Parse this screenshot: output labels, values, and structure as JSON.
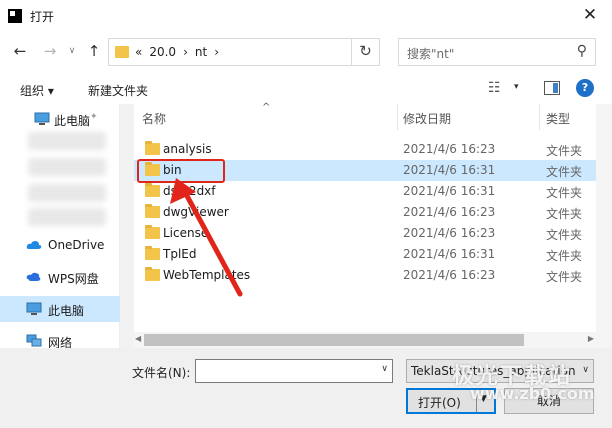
{
  "window": {
    "title": "打开",
    "close_glyph": "✕"
  },
  "nav": {
    "back": "←",
    "forward": "→",
    "down": "∨",
    "up": "↑",
    "breadcrumb": [
      "«",
      "20.0",
      "›",
      "nt",
      "›"
    ],
    "refresh": "↻",
    "addr_drop": "∨",
    "search_placeholder": "搜索\"nt\"",
    "search_icon": "⚲"
  },
  "toolbar": {
    "organize": "组织 ▾",
    "new_folder": "新建文件夹",
    "view_icon": "☷",
    "view_arrow": "▾",
    "help": "?"
  },
  "sidebar": {
    "items": [
      {
        "label": "此电脑",
        "icon": "computer-icon"
      },
      {
        "label": "OneDrive",
        "icon": "cloud-icon"
      },
      {
        "label": "WPS网盘",
        "icon": "wps-icon"
      },
      {
        "label": "此电脑",
        "icon": "computer-icon"
      },
      {
        "label": "网络",
        "icon": "network-icon"
      }
    ],
    "pin": "📌"
  },
  "columns": {
    "name": "名称",
    "date": "修改日期",
    "type": "类型",
    "sort_arrow": "^"
  },
  "files": [
    {
      "name": "analysis",
      "date": "2021/4/6 16:23",
      "type": "文件夹"
    },
    {
      "name": "bin",
      "date": "2021/4/6 16:31",
      "type": "文件夹"
    },
    {
      "name": "dsta2dxf",
      "date": "2021/4/6 16:31",
      "type": "文件夹"
    },
    {
      "name": "dwgViewer",
      "date": "2021/4/6 16:23",
      "type": "文件夹"
    },
    {
      "name": "License",
      "date": "2021/4/6 16:23",
      "type": "文件夹"
    },
    {
      "name": "TplEd",
      "date": "2021/4/6 16:31",
      "type": "文件夹"
    },
    {
      "name": "WebTemplates",
      "date": "2021/4/6 16:23",
      "type": "文件夹"
    }
  ],
  "selected_file_index": 1,
  "bottom": {
    "filename_label": "文件名(N):",
    "filename_value": "",
    "filter_value": "TeklaStructures_application",
    "open_label": "打开(O)",
    "cancel_label": "取消"
  },
  "watermark": {
    "line1": "极光下载站",
    "line2": "www.zb0.com"
  },
  "colors": {
    "selection": "#cce8ff",
    "highlight": "#e1251b",
    "folder": "#f3c44a",
    "accent": "#0078d7"
  }
}
